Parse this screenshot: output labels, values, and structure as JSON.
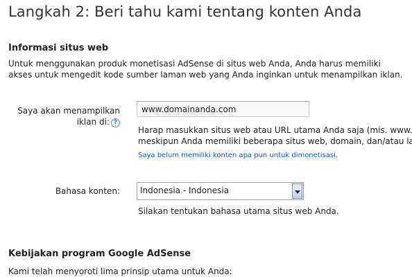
{
  "page": {
    "title": "Langkah 2: Beri tahu kami tentang konten Anda"
  },
  "site_info": {
    "heading": "Informasi situs web",
    "description_line1": "Untuk menggunakan produk monetisasi AdSense di situs web Anda, Anda harus memiliki",
    "description_line2": "akses untuk mengedit kode sumber laman web yang Anda inginkan untuk menampilkan iklan."
  },
  "site_field": {
    "label_line1": "Saya akan menampilkan",
    "label_line2": "iklan di:",
    "help_icon": "question-icon",
    "value": "www.domainanda.com",
    "hint_line1": "Harap masukkan situs web atau URL utama Anda saja (mis. www.ex",
    "hint_line2": "meskipun Anda memiliki beberapa situs web, domain, dan/atau lama",
    "no_content_link": "Saya belum memiliki konten apa pun untuk dimonetisasi."
  },
  "language_field": {
    "label": "Bahasa konten:",
    "selected": "Indonesia - Indonesia",
    "hint": "Silakan tentukan bahasa utama situs web Anda."
  },
  "policy": {
    "heading": "Kebijakan program Google AdSense",
    "intro": "Kami telah menyoroti lima prinsip utama untuk Anda:"
  },
  "colors": {
    "link": "#1155cc",
    "title": "#333333",
    "help_icon": "#2a6fd6"
  }
}
